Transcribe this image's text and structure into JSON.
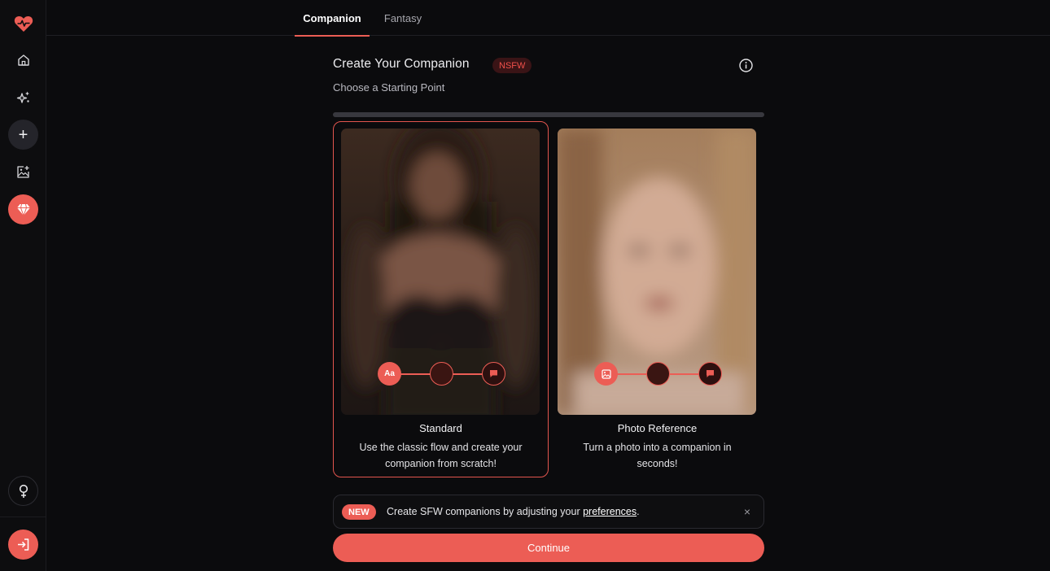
{
  "sidebar": {
    "items": [
      {
        "icon": "heart-pulse-logo-icon"
      },
      {
        "icon": "home-icon"
      },
      {
        "icon": "sparkles-icon"
      },
      {
        "icon": "plus-icon"
      },
      {
        "icon": "image-add-icon"
      },
      {
        "icon": "diamond-icon"
      },
      {
        "icon": "female-symbol-icon"
      },
      {
        "icon": "login-icon"
      }
    ],
    "plus_glyph": "+"
  },
  "tabs": [
    {
      "label": "Companion",
      "active": true
    },
    {
      "label": "Fantasy",
      "active": false
    }
  ],
  "header": {
    "title": "Create Your Companion",
    "badge": "NSFW",
    "subtitle": "Choose a Starting Point",
    "info_icon": "info-icon"
  },
  "progress": {
    "value": 0
  },
  "cards": [
    {
      "title": "Standard",
      "description": "Use the classic flow and create your companion from scratch!",
      "selected": true,
      "steps": [
        {
          "icon": "text-icon",
          "glyph": "Aa",
          "active": true
        },
        {
          "icon": "empty",
          "active": false
        },
        {
          "icon": "chat-icon",
          "active": false
        }
      ]
    },
    {
      "title": "Photo Reference",
      "description": "Turn a photo into a companion in seconds!",
      "selected": false,
      "steps": [
        {
          "icon": "image-icon",
          "active": true
        },
        {
          "icon": "empty",
          "active": false
        },
        {
          "icon": "chat-icon",
          "active": false
        }
      ]
    }
  ],
  "notice": {
    "badge": "NEW",
    "text_before": "Create SFW companions by adjusting your ",
    "link": "preferences",
    "text_after": ".",
    "close_glyph": "×"
  },
  "continue_label": "Continue",
  "colors": {
    "accent": "#ec5d55",
    "background": "#0b0b0d",
    "badge_bg": "#3a1416"
  }
}
